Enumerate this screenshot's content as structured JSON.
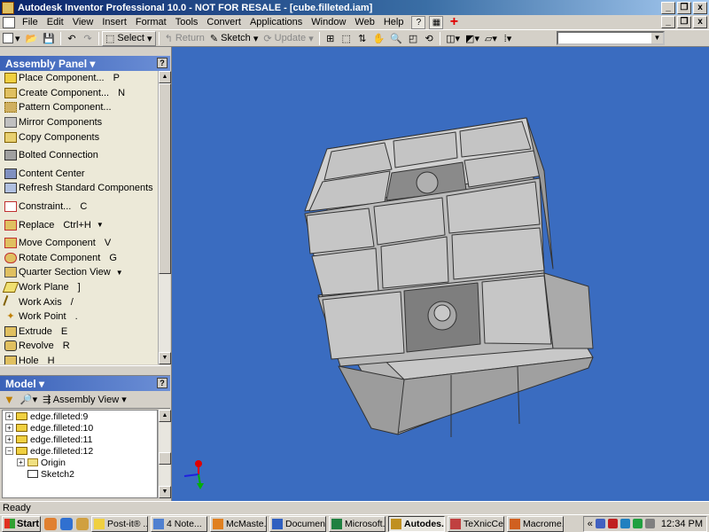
{
  "window": {
    "title": "Autodesk Inventor Professional 10.0 - NOT FOR RESALE - [cube.filleted.iam]",
    "min_label": "_",
    "restore_label": "❐",
    "close_label": "x"
  },
  "menu": {
    "items": [
      "File",
      "Edit",
      "View",
      "Insert",
      "Format",
      "Tools",
      "Convert",
      "Applications",
      "Window",
      "Web",
      "Help"
    ]
  },
  "toolbar": {
    "select_label": "Select",
    "return_label": "Return",
    "sketch_label": "Sketch",
    "update_label": "Update",
    "combo_value": ""
  },
  "assembly_panel": {
    "title": "Assembly Panel ▾",
    "help": "?",
    "items": [
      {
        "label": "Place Component...",
        "key": "P",
        "icon": "place-component-icon"
      },
      {
        "label": "Create Component...",
        "key": "N",
        "icon": "create-component-icon"
      },
      {
        "label": "Pattern Component...",
        "key": "",
        "icon": "pattern-component-icon"
      },
      {
        "label": "Mirror Components",
        "key": "",
        "icon": "mirror-components-icon"
      },
      {
        "label": "Copy Components",
        "key": "",
        "icon": "copy-components-icon"
      },
      {
        "label": "Bolted Connection",
        "key": "",
        "icon": "bolted-connection-icon"
      },
      {
        "label": "Content Center",
        "key": "",
        "icon": "content-center-icon"
      },
      {
        "label": "Refresh Standard Components",
        "key": "",
        "icon": "refresh-icon"
      },
      {
        "label": "Constraint...",
        "key": "C",
        "icon": "constraint-icon"
      },
      {
        "label": "Replace",
        "key": "Ctrl+H",
        "icon": "replace-icon"
      },
      {
        "label": "Move Component",
        "key": "V",
        "icon": "move-component-icon"
      },
      {
        "label": "Rotate Component",
        "key": "G",
        "icon": "rotate-component-icon"
      },
      {
        "label": "Quarter Section View",
        "key": "",
        "icon": "section-view-icon"
      },
      {
        "label": "Work Plane",
        "key": "]",
        "icon": "work-plane-icon"
      },
      {
        "label": "Work Axis",
        "key": "/",
        "icon": "work-axis-icon"
      },
      {
        "label": "Work Point",
        "key": ".",
        "icon": "work-point-icon"
      },
      {
        "label": "Extrude",
        "key": "E",
        "icon": "extrude-icon"
      },
      {
        "label": "Revolve",
        "key": "R",
        "icon": "revolve-icon"
      },
      {
        "label": "Hole",
        "key": "H",
        "icon": "hole-icon"
      }
    ]
  },
  "model_panel": {
    "title": "Model ▾",
    "help": "?",
    "view_label": "Assembly View",
    "tree": [
      {
        "label": "edge.filleted:9",
        "type": "part",
        "indent": 0
      },
      {
        "label": "edge.filleted:10",
        "type": "part",
        "indent": 0
      },
      {
        "label": "edge.filleted:11",
        "type": "part",
        "indent": 0
      },
      {
        "label": "edge.filleted:12",
        "type": "part",
        "indent": 0
      },
      {
        "label": "Origin",
        "type": "folder",
        "indent": 1
      },
      {
        "label": "Sketch2",
        "type": "sketch",
        "indent": 1
      }
    ]
  },
  "status": {
    "text": "Ready"
  },
  "taskbar": {
    "start_label": "Start",
    "tasks": [
      {
        "label": "Post-it® ...",
        "active": false,
        "color": "#f0d040"
      },
      {
        "label": "4 Note...",
        "active": false,
        "color": "#5080d0"
      },
      {
        "label": "McMaste...",
        "active": false,
        "color": "#e08020"
      },
      {
        "label": "Documen...",
        "active": false,
        "color": "#3060c0"
      },
      {
        "label": "Microsoft...",
        "active": false,
        "color": "#208040"
      },
      {
        "label": "Autodes...",
        "active": true,
        "color": "#c09020"
      },
      {
        "label": "TeXnicCe...",
        "active": false,
        "color": "#c04040"
      },
      {
        "label": "Macrome...",
        "active": false,
        "color": "#d06020"
      }
    ],
    "clock": "12:34 PM"
  },
  "colors": {
    "viewport_bg": "#3a6cc0",
    "panel_header": "#3b62b8"
  }
}
